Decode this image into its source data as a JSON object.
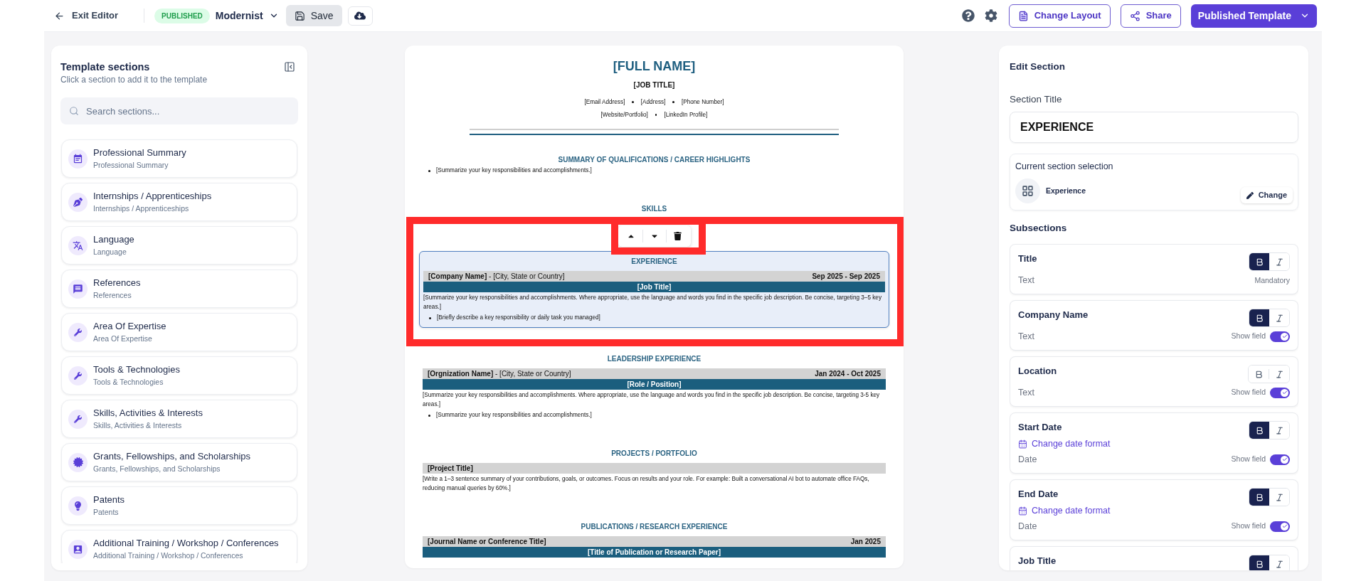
{
  "top_bar": {
    "back": "Exit Editor",
    "status": "PUBLISHED",
    "template": "Modernist",
    "save": "Save",
    "actions": [
      {
        "kind": "layout",
        "label": "Change Layout"
      },
      {
        "kind": "share",
        "label": "Share"
      }
    ],
    "publish": "Published Template"
  },
  "sections_panel": {
    "title": "Template sections",
    "subtitle": "Click a section to add it to the template",
    "search": {
      "placeholder": "Search sections..."
    },
    "items": [
      {
        "title": "Professional Summary",
        "subtitle": "Professional Summary"
      },
      {
        "title": "Internships / Apprenticeships",
        "subtitle": "Internships / Apprenticeships"
      },
      {
        "title": "Language",
        "subtitle": "Language"
      },
      {
        "title": "References",
        "subtitle": "References"
      },
      {
        "title": "Area Of Expertise",
        "subtitle": "Area Of Expertise"
      },
      {
        "title": "Tools & Technologies",
        "subtitle": "Tools & Technologies"
      },
      {
        "title": "Skills, Activities & Interests",
        "subtitle": "Skills, Activities & Interests"
      },
      {
        "title": "Grants, Fellowships, and Scholarships",
        "subtitle": "Grants, Fellowships, and Scholarships"
      },
      {
        "title": "Patents",
        "subtitle": "Patents"
      },
      {
        "title": "Additional Training / Workshop / Conferences",
        "subtitle": "Additional Training / Workshop / Conferences"
      }
    ]
  },
  "resume": {
    "name": "[FULL NAME]",
    "job_title": "[JOB TITLE]",
    "contact_lines": [
      [
        "[Email Address]",
        "[Address]",
        "[Phone Number]"
      ],
      [
        "[Website/Portfolio]",
        "[LinkedIn Profile]"
      ]
    ],
    "sections": [
      {
        "heading": "SUMMARY OF QUALIFICATIONS / CAREER HIGHLIGHTS",
        "selected": false,
        "bullets": [
          "[Summarize your key responsibilities and accomplishments.]"
        ]
      },
      {
        "heading": "SKILLS",
        "selected": false
      },
      {
        "heading": "EXPERIENCE",
        "selected": true,
        "entries": [
          {
            "header": "**[Company Name]** - [City, State or Country]",
            "dates": "Sep 2025 - Sep 2025",
            "bar": "[Job Title]",
            "paragraph": "[Summarize your key responsibilities and accomplishments. Where appropriate, use the language and words you find in the specific job description. Be concise, targeting 3–5 key areas.]",
            "bullets": [
              "[Briefly describe a key responsibility or daily task you managed]"
            ]
          }
        ]
      },
      {
        "heading": "LEADERSHIP EXPERIENCE",
        "selected": false,
        "entries": [
          {
            "header": "**[Orgnization Name]** - [City, State or Country]",
            "dates": "Jan 2024 - Oct 2025",
            "bar": "[Role / Position]",
            "paragraph": "[Summarize your key responsibilities and accomplishments. Where appropriate, use the language and words you find in the specific job description. Be concise, targeting 3-5 key areas.]",
            "bullets": [
              "[Summarize your key responsibilities and accomplishments.]"
            ]
          }
        ]
      },
      {
        "heading": "PROJECTS / PORTFOLIO",
        "selected": false,
        "entries": [
          {
            "title": "[Project Title]",
            "paragraph": "[Write a 1–3 sentence summary of your contributions, goals, or outcomes. Focus on results and your role. For example: Built a conversational AI bot to automate office FAQs, reducing manual queries by 60%.]"
          }
        ]
      },
      {
        "heading": "PUBLICATIONS / RESEARCH EXPERIENCE",
        "selected": false,
        "entries": [
          {
            "title": "[Journal Name or Conference Title]",
            "dates": "Jan 2025",
            "bar": "[Title of Publication or Research Paper]"
          }
        ]
      }
    ]
  },
  "editor": {
    "title": "Edit Section",
    "section_title": {
      "label": "Section Title",
      "value": "EXPERIENCE"
    },
    "current_selection": {
      "label": "Current section selection",
      "name": "Experience",
      "action": "Change"
    },
    "subsections_heading": "Subsections",
    "subsections": [
      {
        "name": "Title",
        "bold": true,
        "italic": false,
        "type": "Text",
        "note": "Mandatory"
      },
      {
        "name": "Company Name",
        "bold": true,
        "italic": false,
        "type": "Text",
        "show_field": {
          "label": "Show field",
          "on": true
        }
      },
      {
        "name": "Location",
        "bold": false,
        "italic": false,
        "type": "Text",
        "show_field": {
          "label": "Show field",
          "on": true
        }
      },
      {
        "name": "Start Date",
        "bold": true,
        "italic": false,
        "link": "Change date format",
        "type": "Date",
        "show_field": {
          "label": "Show field",
          "on": true
        }
      },
      {
        "name": "End Date",
        "bold": true,
        "italic": false,
        "link": "Change date format",
        "type": "Date",
        "show_field": {
          "label": "Show field",
          "on": true
        }
      },
      {
        "name": "Job Title",
        "bold": true,
        "italic": false
      }
    ]
  }
}
